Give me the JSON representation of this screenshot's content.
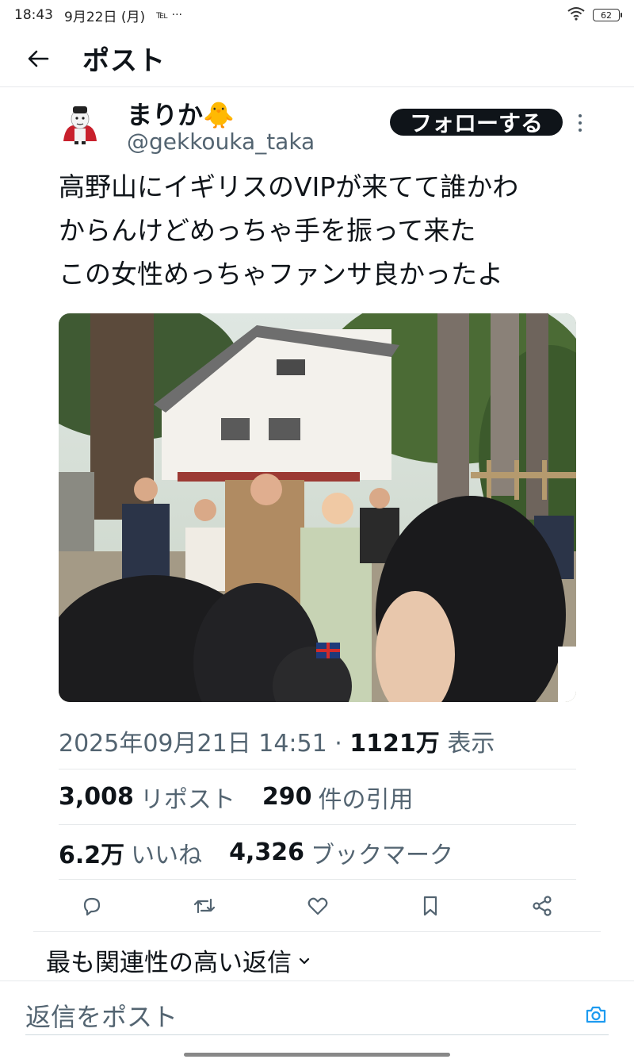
{
  "status_bar": {
    "time": "18:43",
    "date": "9月22日 (月)",
    "notif": "℡ ···",
    "battery": "62"
  },
  "header": {
    "title": "ポスト"
  },
  "post": {
    "author_name": "まりか🐥",
    "author_handle": "@gekkouka_taka",
    "follow_label": "フォローする",
    "text_lines": [
      "高野山にイギリスのVIPが来てて誰かわ",
      "からんけどめっちゃ手を振って来た",
      "この女性めっちゃファンサ良かったよ"
    ],
    "timestamp": "2025年09月21日 14:51 · ",
    "views_count": "1121万",
    "views_label": " 表示"
  },
  "stats": {
    "reposts_count": "3,008",
    "reposts_label": "リポスト",
    "quotes_count": "290",
    "quotes_label": "件の引用",
    "likes_count": "6.2万",
    "likes_label": "いいね",
    "bookmarks_count": "4,326",
    "bookmarks_label": "ブックマーク"
  },
  "replies": {
    "sort_label": "最も関連性の高い返信"
  },
  "reply_bar": {
    "placeholder": "返信をポスト"
  },
  "colors": {
    "text": "#0f1419",
    "secondary": "#536471",
    "accent": "#1d9bf0",
    "divider": "#e6e9eb"
  }
}
